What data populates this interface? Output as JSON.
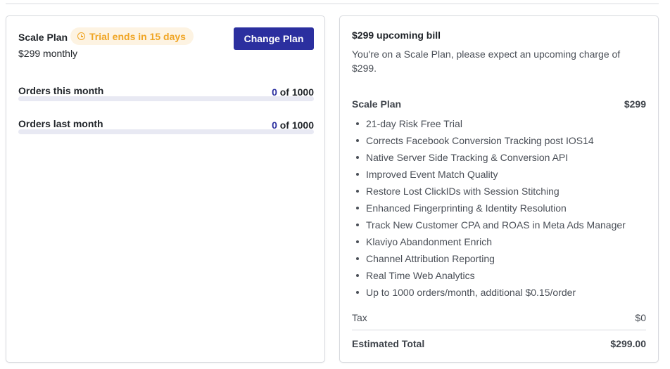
{
  "plan": {
    "name": "Scale Plan",
    "trial_badge": "Trial ends in 15 days",
    "price_text": "$299 monthly",
    "change_button": "Change Plan"
  },
  "usage": [
    {
      "label": "Orders this month",
      "used": "0",
      "of_text": "of 1000",
      "fraction": 0
    },
    {
      "label": "Orders last month",
      "used": "0",
      "of_text": "of 1000",
      "fraction": 0
    }
  ],
  "bill": {
    "title": "$299 upcoming bill",
    "description": "You're on a Scale Plan, please expect an upcoming charge of $299.",
    "plan_label": "Scale Plan",
    "plan_price": "$299",
    "features": [
      "21-day Risk Free Trial",
      "Corrects Facebook Conversion Tracking post IOS14",
      "Native Server Side Tracking & Conversion API",
      "Improved Event Match Quality",
      "Restore Lost ClickIDs with Session Stitching",
      "Enhanced Fingerprinting & Identity Resolution",
      "Track New Customer CPA and ROAS in Meta Ads Manager",
      "Klaviyo Abandonment Enrich",
      "Channel Attribution Reporting",
      "Real Time Web Analytics",
      "Up to 1000 orders/month, additional $0.15/order"
    ],
    "tax_label": "Tax",
    "tax_value": "$0",
    "total_label": "Estimated Total",
    "total_value": "$299.00"
  },
  "colors": {
    "primary": "#2b2f9f",
    "trial_text": "#f0a524",
    "trial_bg": "#fdf3e2",
    "bar_track": "#e8e9f3"
  },
  "icons": {
    "trial": "clock-icon"
  }
}
